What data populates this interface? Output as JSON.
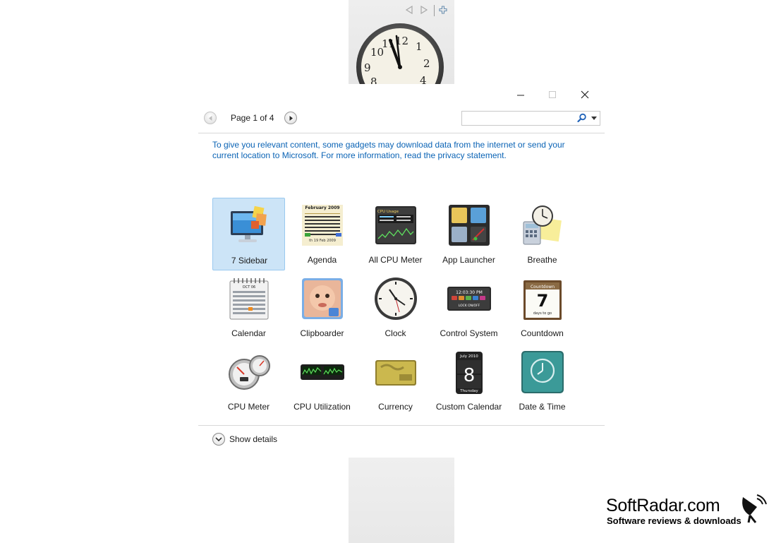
{
  "window": {
    "pager": {
      "label": "Page 1 of 4"
    },
    "search": {
      "placeholder": ""
    },
    "notice": "To give you relevant content, some gadgets may download data from the internet or send your current location to Microsoft. For more information, read the privacy statement.",
    "gadgets": [
      {
        "label": "7 Sidebar",
        "icon": "monitor-icon",
        "selected": true
      },
      {
        "label": "Agenda",
        "icon": "agenda-calendar-icon",
        "selected": false
      },
      {
        "label": "All CPU Meter",
        "icon": "cpu-meter-panel-icon",
        "selected": false
      },
      {
        "label": "App Launcher",
        "icon": "app-launcher-icon",
        "selected": false
      },
      {
        "label": "Breathe",
        "icon": "breathe-clock-calculator-icon",
        "selected": false
      },
      {
        "label": "Calendar",
        "icon": "spiral-calendar-icon",
        "selected": false
      },
      {
        "label": "Clipboarder",
        "icon": "baby-photo-icon",
        "selected": false
      },
      {
        "label": "Clock",
        "icon": "clock-icon",
        "selected": false
      },
      {
        "label": "Control System",
        "icon": "control-system-icon",
        "selected": false
      },
      {
        "label": "Countdown",
        "icon": "countdown-calendar-icon",
        "selected": false
      },
      {
        "label": "CPU Meter",
        "icon": "cpu-gauges-icon",
        "selected": false
      },
      {
        "label": "CPU Utilization",
        "icon": "cpu-graph-icon",
        "selected": false
      },
      {
        "label": "Currency",
        "icon": "currency-card-icon",
        "selected": false
      },
      {
        "label": "Custom Calendar",
        "icon": "custom-calendar-icon",
        "selected": false
      },
      {
        "label": "Date & Time",
        "icon": "date-time-clock-icon",
        "selected": false
      }
    ],
    "details_label": "Show details"
  },
  "sidebar_strip": {
    "clock_numbers": [
      "12",
      "1",
      "2",
      "10",
      "11",
      "9",
      "4",
      "8"
    ]
  },
  "icon_text": {
    "agenda_month": "February 2009",
    "agenda_footer": "th 19 Feb 2009",
    "cpu_title": "CPU Usage",
    "control_time": "12:03:30 PM",
    "control_lock": "LOCK ON/OFF",
    "countdown_title": "Countdown",
    "countdown_value": "7",
    "countdown_sub": "days to go",
    "custom_cal_month": "July 2010",
    "custom_cal_day": "8",
    "custom_cal_weekday": "Thursday",
    "calendar_month": "OCT 06"
  },
  "brand": {
    "name": "SoftRadar.com",
    "tagline": "Software reviews & downloads"
  },
  "colors": {
    "link": "#0a63b5",
    "selection_fill": "#cce4f7",
    "selection_border": "#99c9ef"
  }
}
